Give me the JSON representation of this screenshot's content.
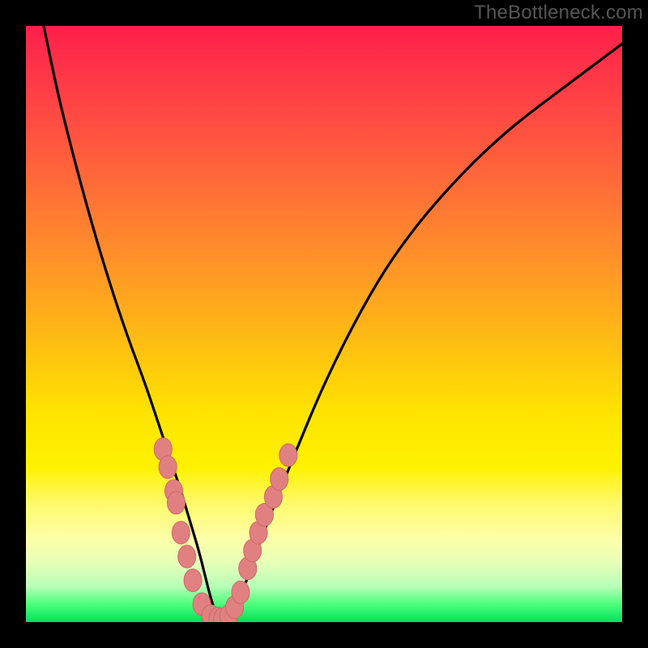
{
  "watermark": "TheBottleneck.com",
  "colors": {
    "curve": "#000000",
    "marker_fill": "#e08080",
    "marker_stroke": "#d06868",
    "background_frame": "#000000"
  },
  "chart_data": {
    "type": "line",
    "title": "",
    "xlabel": "",
    "ylabel": "",
    "xlim": [
      0,
      100
    ],
    "ylim": [
      0,
      100
    ],
    "series": [
      {
        "name": "bottleneck-curve",
        "x": [
          3,
          5,
          8,
          11,
          14,
          17,
          20,
          22,
          24,
          26,
          27.5,
          29,
          30,
          31,
          32,
          33,
          34,
          36,
          38,
          41,
          45,
          50,
          56,
          62,
          70,
          80,
          92,
          100
        ],
        "values": [
          100,
          90,
          78,
          67,
          57,
          48,
          40,
          34,
          28,
          22,
          17,
          12,
          8,
          4,
          1,
          0.5,
          1,
          4,
          10,
          18,
          28,
          40,
          52,
          62,
          72,
          82,
          91,
          97
        ]
      }
    ],
    "markers": {
      "name": "highlighted-points",
      "x_values": [
        [
          23.0,
          29
        ],
        [
          23.8,
          26
        ],
        [
          24.8,
          22
        ],
        [
          25.2,
          20
        ],
        [
          26.0,
          15
        ],
        [
          27.0,
          11
        ],
        [
          28.0,
          7
        ],
        [
          29.5,
          3
        ],
        [
          31.0,
          1
        ],
        [
          32.2,
          0.6
        ],
        [
          33.0,
          0.5
        ],
        [
          34.0,
          1
        ],
        [
          35.0,
          2.5
        ],
        [
          36.0,
          5
        ],
        [
          37.2,
          9
        ],
        [
          38.0,
          12
        ],
        [
          39.0,
          15
        ],
        [
          40.0,
          18
        ],
        [
          41.5,
          21
        ],
        [
          42.5,
          24
        ],
        [
          44.0,
          28
        ]
      ]
    }
  }
}
